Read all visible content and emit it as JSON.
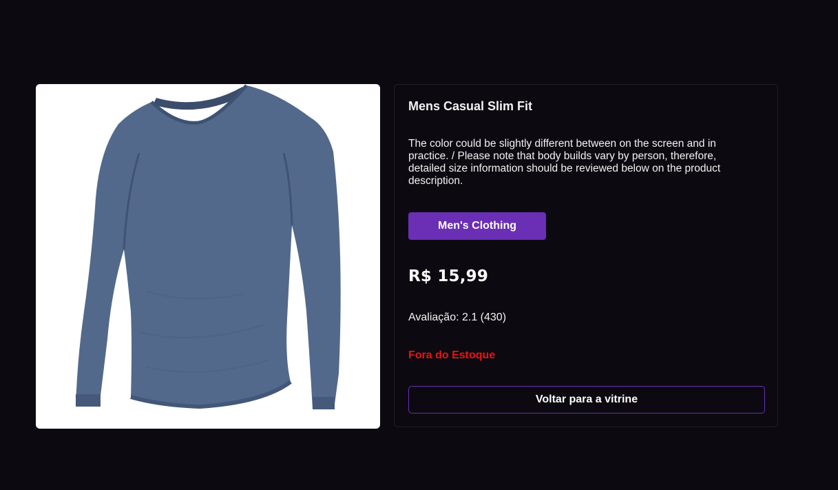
{
  "product": {
    "image_icon": "shirt-photo",
    "title": "Mens Casual Slim Fit",
    "description": "The color could be slightly different between on the screen and in practice. / Please note that body builds vary by person, therefore, detailed size information should be reviewed below on the product description.",
    "category_label": "Men's Clothing",
    "price": "R$ 15,99",
    "rating_text": "Avaliação: 2.1 (430)",
    "stock_status": "Fora do Estoque",
    "back_label": "Voltar para a vitrine"
  },
  "colors": {
    "background": "#0c0a10",
    "accent": "#6a2fb5",
    "out_of_stock": "#ee1111",
    "shirt": "#4f6688"
  }
}
